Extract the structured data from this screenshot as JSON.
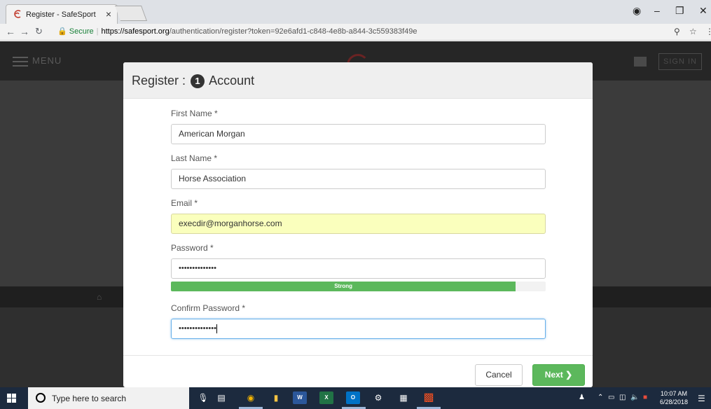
{
  "browser": {
    "tab_title": "Register - SafeSport",
    "tab_close": "×",
    "url_secure_label": "Secure",
    "url_host": "https://safesport.org",
    "url_path": "/authentication/register?token=92e6afd1-c848-4e8b-a844-3c559383f49e"
  },
  "site": {
    "menu_label": "MENU",
    "signin_label": "SIGN IN"
  },
  "modal": {
    "title_prefix": "Register :",
    "step_number": "1",
    "title_suffix": "Account",
    "fields": {
      "first_name_label": "First Name *",
      "first_name_value": "American Morgan",
      "last_name_label": "Last Name *",
      "last_name_value": "Horse Association",
      "email_label": "Email *",
      "email_value": "execdir@morganhorse.com",
      "password_label": "Password *",
      "password_value": "••••••••••••••",
      "confirm_label": "Confirm Password *",
      "confirm_value": "••••••••••••••"
    },
    "strength": {
      "label": "Strong",
      "percent": 92,
      "color": "#5cb85c"
    },
    "cancel_label": "Cancel",
    "next_label": "Next ❯"
  },
  "taskbar": {
    "search_placeholder": "Type here to search",
    "time": "10:07 AM",
    "date": "6/28/2018"
  }
}
